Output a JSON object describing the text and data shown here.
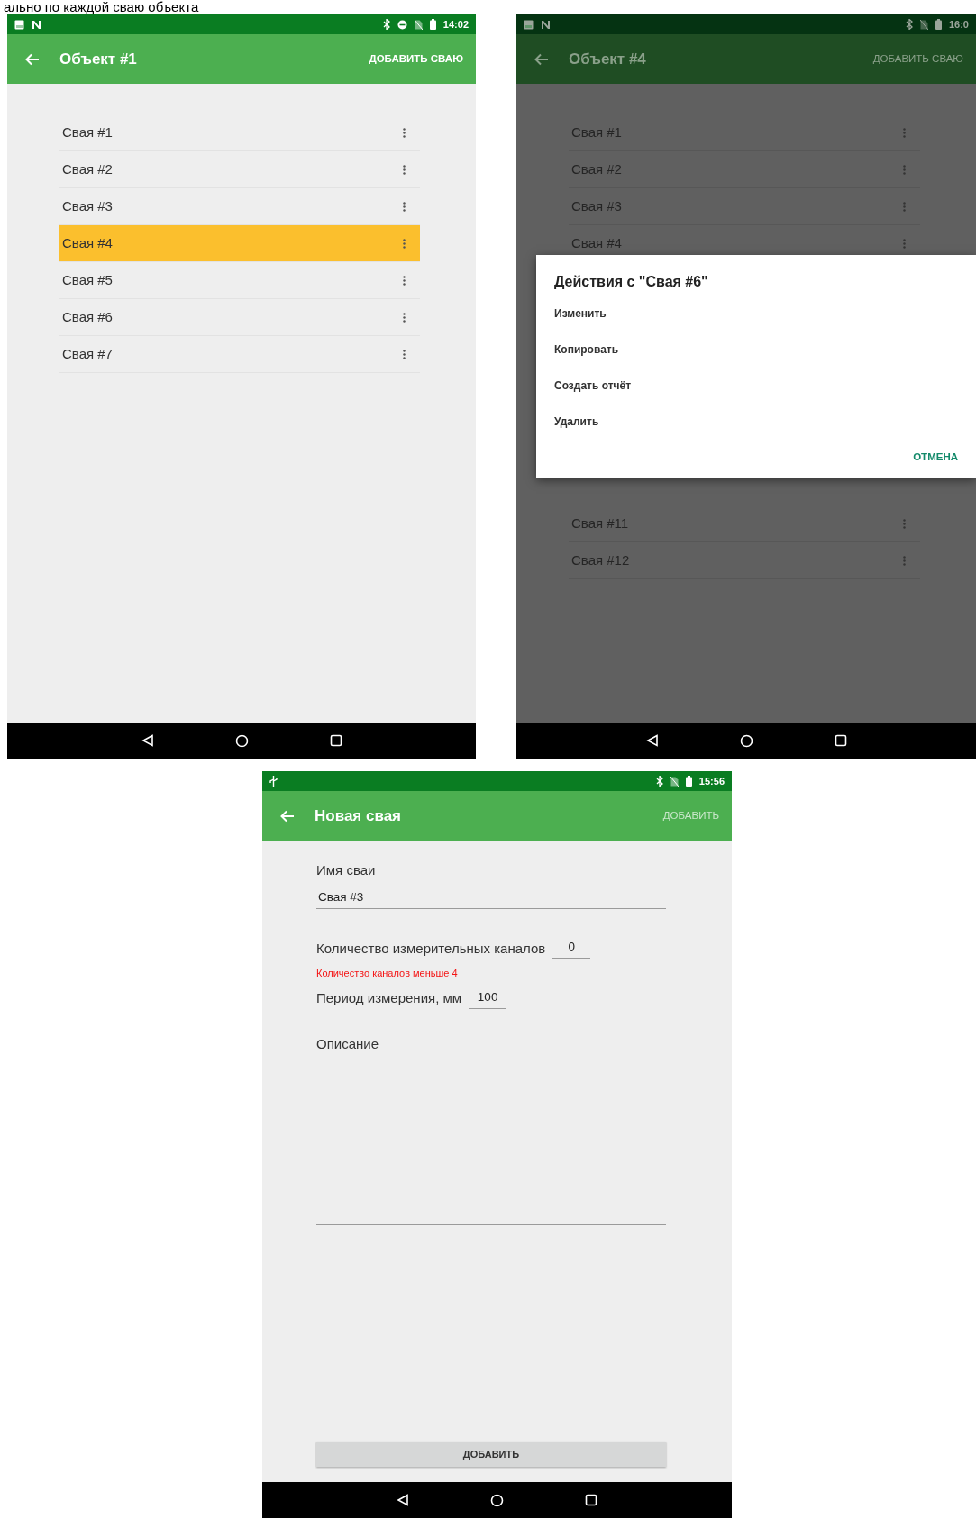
{
  "caption": "ально по каждой сваю объекта",
  "screens": [
    {
      "kind": "list",
      "dimmed": false,
      "status_bar": {
        "time": "14:02"
      },
      "app_bar": {
        "title": "Объект #1",
        "action": "ДОБАВИТЬ СВАЮ",
        "disabled": false
      },
      "items": [
        {
          "label": "Свая #1",
          "selected": false
        },
        {
          "label": "Свая #2",
          "selected": false
        },
        {
          "label": "Свая #3",
          "selected": false
        },
        {
          "label": "Свая #4",
          "selected": true
        },
        {
          "label": "Свая #5",
          "selected": false
        },
        {
          "label": "Свая #6",
          "selected": false
        },
        {
          "label": "Свая #7",
          "selected": false
        }
      ]
    },
    {
      "kind": "list",
      "dimmed": true,
      "status_bar": {
        "time": "16:0"
      },
      "app_bar": {
        "title": "Объект #4",
        "action": "ДОБАВИТЬ СВАЮ",
        "disabled": false
      },
      "items": [
        {
          "label": "Свая #1",
          "selected": false
        },
        {
          "label": "Свая #2",
          "selected": false
        },
        {
          "label": "Свая #3",
          "selected": false
        },
        {
          "label": "Свая #4",
          "selected": false
        },
        {
          "label": "Свая #11",
          "selected": false
        },
        {
          "label": "Свая #12",
          "selected": false
        }
      ],
      "dialog": {
        "title": "Действия с \"Свая #6\"",
        "options": [
          "Изменить",
          "Копировать",
          "Создать отчёт",
          "Удалить"
        ],
        "cancel": "ОТМЕНА"
      }
    },
    {
      "kind": "form",
      "dimmed": false,
      "status_bar": {
        "time": "15:56"
      },
      "app_bar": {
        "title": "Новая свая",
        "action": "ДОБАВИТЬ",
        "disabled": true
      },
      "name_field": {
        "label": "Имя сваи",
        "value": "Свая #3"
      },
      "channels_field": {
        "label": "Количество измерительных каналов",
        "value": "0",
        "error": "Количество каналов меньше 4"
      },
      "period_field": {
        "label": "Период измерения, мм",
        "value": "100"
      },
      "description_field": {
        "label": "Описание"
      },
      "submit": "ДОБАВИТЬ"
    }
  ]
}
